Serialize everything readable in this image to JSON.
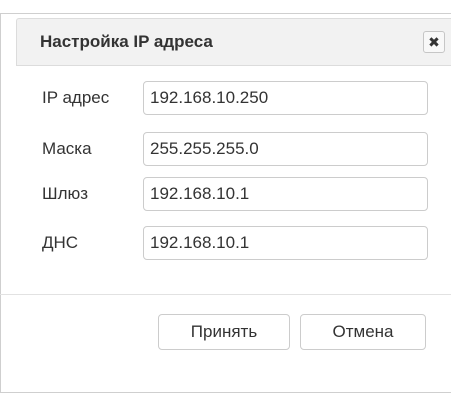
{
  "dialog": {
    "title": "Настройка IP адреса",
    "close_icon": "close-icon",
    "fields": [
      {
        "label": "IP адрес",
        "value": "192.168.10.250"
      },
      {
        "label": "Маска",
        "value": "255.255.255.0"
      },
      {
        "label": "Шлюз",
        "value": "192.168.10.1"
      },
      {
        "label": "ДНС",
        "value": "192.168.10.1"
      }
    ],
    "buttons": {
      "accept_label": "Принять",
      "cancel_label": "Отмена"
    }
  }
}
